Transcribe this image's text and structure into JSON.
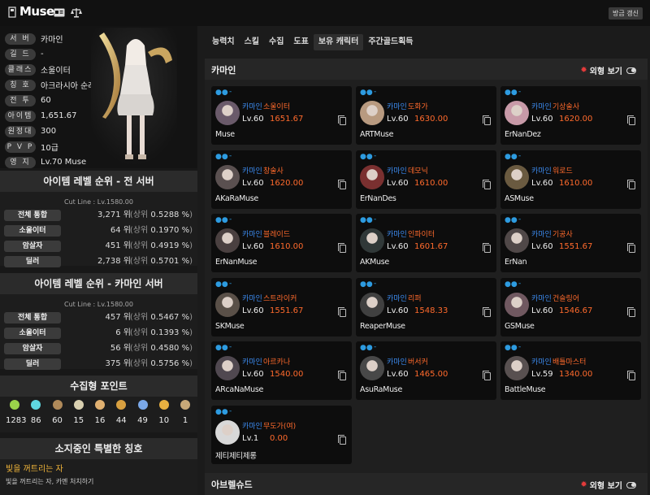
{
  "header": {
    "name": "Muse",
    "refresh_label": "방금 갱신"
  },
  "profile": {
    "rows": [
      {
        "label": "서 버",
        "value": "카마인"
      },
      {
        "label": "길 드",
        "value": "-"
      },
      {
        "label": "클래스",
        "value": "소울이터"
      },
      {
        "label": "칭 호",
        "value": "아크라시아 순례자"
      },
      {
        "label": "전 투",
        "value": "60"
      },
      {
        "label": "아이템",
        "value": "1,651.67"
      },
      {
        "label": "원정대",
        "value": "300"
      },
      {
        "label": "P V P",
        "value": "10급"
      },
      {
        "label": "영 지",
        "value": "Lv.70 Muse"
      }
    ]
  },
  "rank_all": {
    "title": "아이템 레벨 순위 - 전 서버",
    "cutline": "Cut Line : Lv.1580.00",
    "rows": [
      {
        "label": "전체 통합",
        "rank": "3,271 위",
        "pct": "0.5288 %"
      },
      {
        "label": "소울이터",
        "rank": "64 위",
        "pct": "0.1970 %"
      },
      {
        "label": "암살자",
        "rank": "451 위",
        "pct": "0.4919 %"
      },
      {
        "label": "딜러",
        "rank": "2,738 위",
        "pct": "0.5701 %"
      }
    ]
  },
  "rank_server": {
    "title": "아이템 레벨 순위 - 카마인 서버",
    "cutline": "Cut Line : Lv.1580.00",
    "rows": [
      {
        "label": "전체 통합",
        "rank": "457 위",
        "pct": "0.5467 %"
      },
      {
        "label": "소울이터",
        "rank": "6 위",
        "pct": "0.1393 %"
      },
      {
        "label": "암살자",
        "rank": "56 위",
        "pct": "0.4580 %"
      },
      {
        "label": "딜러",
        "rank": "375 위",
        "pct": "0.5756 %"
      }
    ]
  },
  "rank_words": {
    "open": "(상위",
    "close": ")"
  },
  "collect": {
    "title": "수집형 포인트",
    "items": [
      {
        "icon": "seed-icon",
        "color": "#9bd34a",
        "value": "1283"
      },
      {
        "icon": "island-heart-icon",
        "color": "#5fd6e0",
        "value": "86"
      },
      {
        "icon": "art-icon",
        "color": "#b08a5a",
        "value": "60"
      },
      {
        "icon": "mokoko-seed-icon",
        "color": "#d9d0b0",
        "value": "15"
      },
      {
        "icon": "adventure-icon",
        "color": "#e0b070",
        "value": "16"
      },
      {
        "icon": "igneas-star-icon",
        "color": "#d8a040",
        "value": "44"
      },
      {
        "icon": "world-tree-leaf-icon",
        "color": "#7aa8e8",
        "value": "49"
      },
      {
        "icon": "orpheus-star-icon",
        "color": "#e8b040",
        "value": "10"
      },
      {
        "icon": "orb-icon",
        "color": "#c8a878",
        "value": "1"
      }
    ]
  },
  "titles": {
    "title": "소지중인 특별한 칭호",
    "main": "빛을 꺼트리는 자",
    "sub": "빛을 꺼트리는 자, 카멘 처치하기"
  },
  "tabs": [
    "능력치",
    "스킬",
    "수집",
    "도표",
    "보유 캐릭터",
    "주간골드획득"
  ],
  "active_tab": "보유 캐릭터",
  "server_kamain": {
    "name": "카마인",
    "look_label": "외형 보기"
  },
  "server_abrel": {
    "name": "아브렐슈드",
    "look_label": "외형 보기"
  },
  "characters": [
    {
      "server": "카마인",
      "class": "소울이터",
      "lv": "Lv.60",
      "ilvl": "1651.67",
      "name": "Muse",
      "avatar": "#6a5a6a"
    },
    {
      "server": "카마인",
      "class": "도화가",
      "lv": "Lv.60",
      "ilvl": "1630.00",
      "name": "ARTMuse",
      "avatar": "#b89a80"
    },
    {
      "server": "카마인",
      "class": "기상술사",
      "lv": "Lv.60",
      "ilvl": "1620.00",
      "name": "ErNanDez",
      "avatar": "#c89aa8"
    },
    {
      "server": "카마인",
      "class": "창술사",
      "lv": "Lv.60",
      "ilvl": "1620.00",
      "name": "AKaRaMuse",
      "avatar": "#5a5050"
    },
    {
      "server": "카마인",
      "class": "데모닉",
      "lv": "Lv.60",
      "ilvl": "1610.00",
      "name": "ErNanDes",
      "avatar": "#7a3030"
    },
    {
      "server": "카마인",
      "class": "워로드",
      "lv": "Lv.60",
      "ilvl": "1610.00",
      "name": "ASMuse",
      "avatar": "#6a5a40"
    },
    {
      "server": "카마인",
      "class": "블레이드",
      "lv": "Lv.60",
      "ilvl": "1610.00",
      "name": "ErNanMuse",
      "avatar": "#4a4040"
    },
    {
      "server": "카마인",
      "class": "인파이터",
      "lv": "Lv.60",
      "ilvl": "1601.67",
      "name": "AKMuse",
      "avatar": "#303838"
    },
    {
      "server": "카마인",
      "class": "기공사",
      "lv": "Lv.60",
      "ilvl": "1551.67",
      "name": "ErNan",
      "avatar": "#504848"
    },
    {
      "server": "카마인",
      "class": "스트라이커",
      "lv": "Lv.60",
      "ilvl": "1551.67",
      "name": "SKMuse",
      "avatar": "#5a5048"
    },
    {
      "server": "카마인",
      "class": "리퍼",
      "lv": "Lv.60",
      "ilvl": "1548.33",
      "name": "ReaperMuse",
      "avatar": "#404040"
    },
    {
      "server": "카마인",
      "class": "건슬링어",
      "lv": "Lv.60",
      "ilvl": "1546.67",
      "name": "GSMuse",
      "avatar": "#705860"
    },
    {
      "server": "카마인",
      "class": "아르카나",
      "lv": "Lv.60",
      "ilvl": "1540.00",
      "name": "ARcaNaMuse",
      "avatar": "#504850"
    },
    {
      "server": "카마인",
      "class": "버서커",
      "lv": "Lv.60",
      "ilvl": "1465.00",
      "name": "AsuRaMuse",
      "avatar": "#484848"
    },
    {
      "server": "카마인",
      "class": "배틀마스터",
      "lv": "Lv.59",
      "ilvl": "1340.00",
      "name": "BattleMuse",
      "avatar": "#585050"
    },
    {
      "server": "카마인",
      "class": "무도가(여)",
      "lv": "Lv.1",
      "ilvl": "0.00",
      "name": "제티제티제롱",
      "avatar": "#d8d8d8"
    }
  ]
}
